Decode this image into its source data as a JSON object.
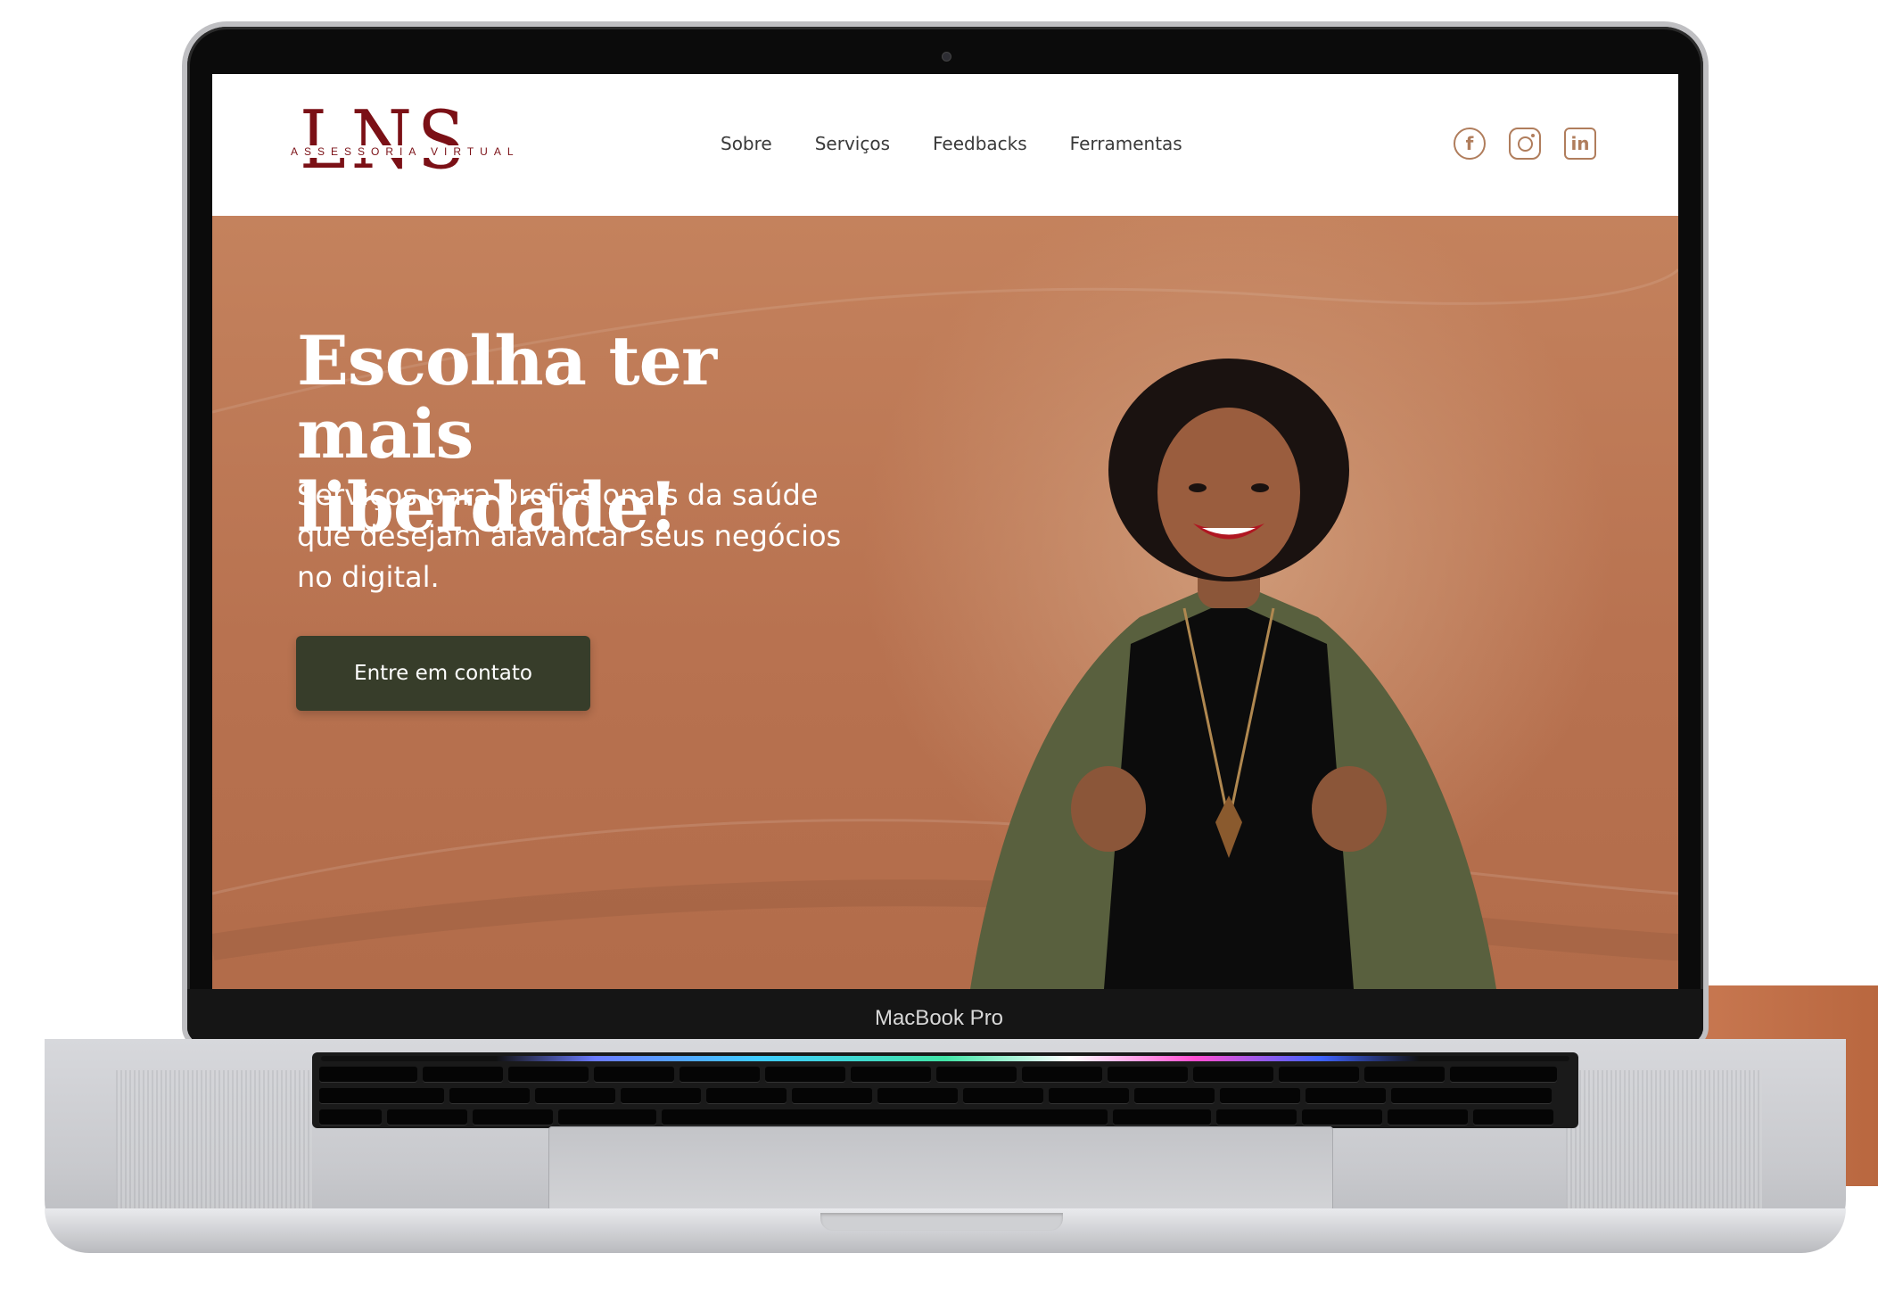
{
  "site": {
    "logo": {
      "monogram": "LNS",
      "subtitle": "ASSESSORIA VIRTUAL"
    },
    "nav": [
      {
        "label": "Sobre"
      },
      {
        "label": "Serviços"
      },
      {
        "label": "Feedbacks"
      },
      {
        "label": "Ferramentas"
      }
    ],
    "socials": [
      {
        "icon": "facebook-icon",
        "glyph": "f"
      },
      {
        "icon": "instagram-icon",
        "glyph": ""
      },
      {
        "icon": "linkedin-icon",
        "glyph": "in"
      }
    ]
  },
  "hero": {
    "headline": "Escolha ter mais liberdade!",
    "subtitle": "Serviços para profissionais da saúde que desejam alavancar seus negócios no digital.",
    "cta_label": "Entre em contato"
  },
  "device": {
    "brand_label": "MacBook Pro"
  },
  "colors": {
    "brand": "#7b1016",
    "hero_bg": "#b87452",
    "cta_bg": "#373d2a",
    "social": "#b07d5c"
  }
}
